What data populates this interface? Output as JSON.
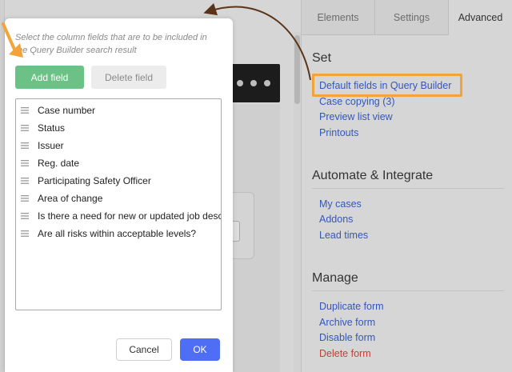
{
  "sidebar": {
    "tabs": [
      {
        "label": "Elements"
      },
      {
        "label": "Settings"
      },
      {
        "label": "Advanced"
      }
    ],
    "sections": [
      {
        "title": "Set",
        "links": [
          {
            "label": "Default fields in Query Builder"
          },
          {
            "label": "Case copying (3)"
          },
          {
            "label": "Preview list view"
          },
          {
            "label": "Printouts"
          }
        ]
      },
      {
        "title": "Automate & Integrate",
        "links": [
          {
            "label": "My cases"
          },
          {
            "label": "Addons"
          },
          {
            "label": "Lead times"
          }
        ]
      },
      {
        "title": "Manage",
        "links": [
          {
            "label": "Duplicate form"
          },
          {
            "label": "Archive form"
          },
          {
            "label": "Disable form"
          },
          {
            "label": "Delete form"
          }
        ]
      }
    ]
  },
  "modal": {
    "description": "Select the column fields that are to be included in the Query Builder search result",
    "add_label": "Add field",
    "delete_label": "Delete field",
    "fields": [
      {
        "label": "Case number"
      },
      {
        "label": "Status"
      },
      {
        "label": "Issuer"
      },
      {
        "label": "Reg. date"
      },
      {
        "label": "Participating Safety Officer"
      },
      {
        "label": "Area of change"
      },
      {
        "label": "Is there a need for new or updated job description?"
      },
      {
        "label": "Are all risks within acceptable levels?"
      }
    ],
    "cancel_label": "Cancel",
    "ok_label": "OK"
  },
  "colors": {
    "accent_highlight": "#f2a33a",
    "add_button": "#6cc286",
    "ok_button": "#4d6ef5",
    "link": "#3557b9",
    "danger_link": "#c0413b"
  }
}
